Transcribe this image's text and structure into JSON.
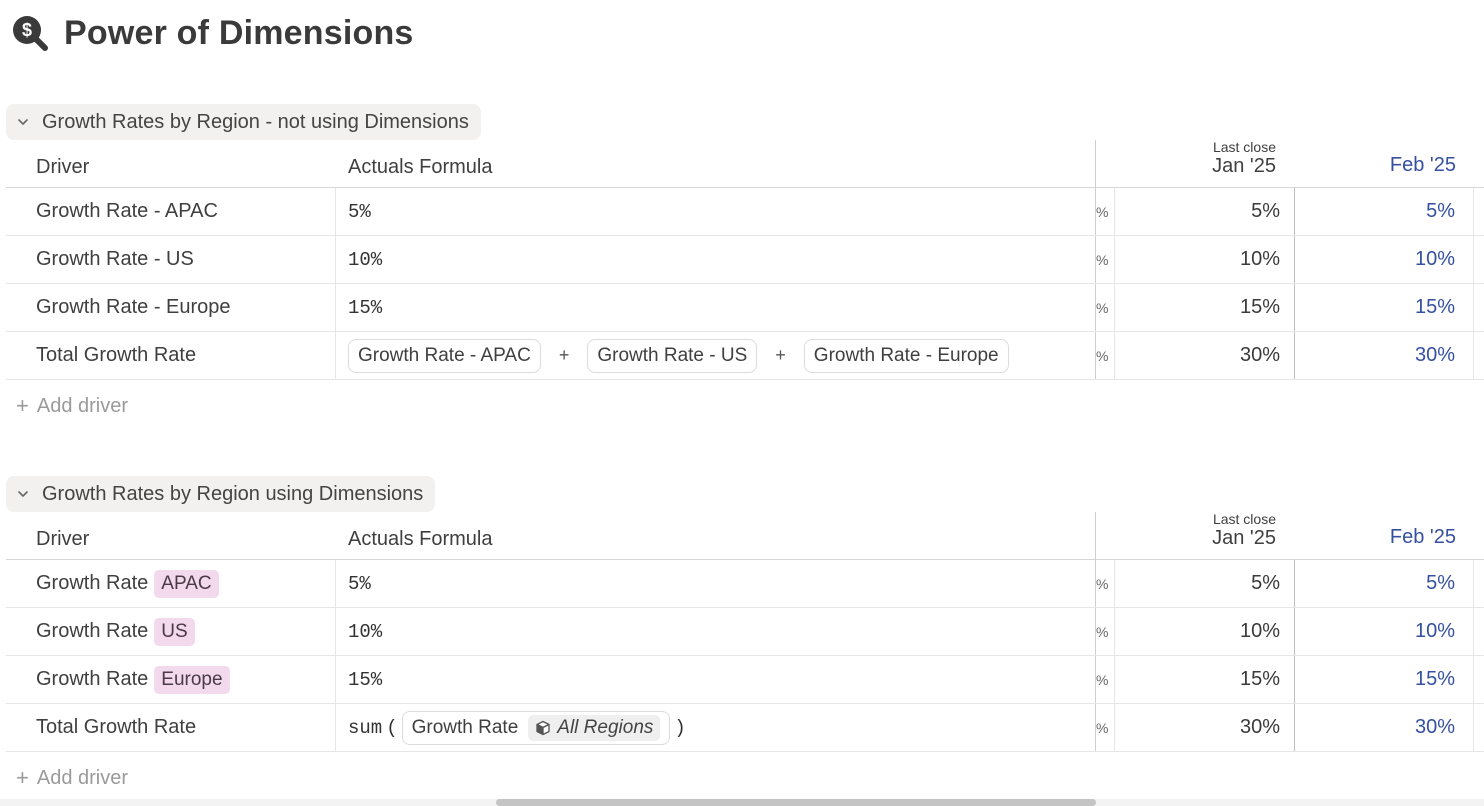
{
  "page": {
    "title": "Power of Dimensions",
    "icon": "search-dollar-icon"
  },
  "colors": {
    "accent_blue": "#3550a0",
    "dimension_tag": "#f3d9ec",
    "block_title_bg": "#f2f1ef"
  },
  "columns": {
    "driver": "Driver",
    "formula": "Actuals Formula",
    "jan_sub": "Last close",
    "jan": "Jan '25",
    "feb": "Feb '25"
  },
  "block1": {
    "title": "Growth Rates by Region - not using Dimensions",
    "rows": [
      {
        "driver": "Growth Rate - APAC",
        "formula": "5%",
        "stub": "%",
        "jan": "5%",
        "feb": "5%"
      },
      {
        "driver": "Growth Rate - US",
        "formula": "10%",
        "stub": "%",
        "jan": "10%",
        "feb": "10%"
      },
      {
        "driver": "Growth Rate - Europe",
        "formula": "15%",
        "stub": "%",
        "jan": "15%",
        "feb": "15%"
      },
      {
        "driver": "Total Growth Rate",
        "chips": [
          "Growth Rate - APAC",
          "Growth Rate - US",
          "Growth Rate - Europe"
        ],
        "op": "+",
        "stub": "%",
        "jan": "30%",
        "feb": "30%"
      }
    ],
    "add_driver": "Add driver"
  },
  "block2": {
    "title": "Growth Rates by Region using Dimensions",
    "rows": [
      {
        "driver": "Growth Rate",
        "tag": "APAC",
        "formula": "5%",
        "stub": "%",
        "jan": "5%",
        "feb": "5%"
      },
      {
        "driver": "Growth Rate",
        "tag": "US",
        "formula": "10%",
        "stub": "%",
        "jan": "10%",
        "feb": "10%"
      },
      {
        "driver": "Growth Rate",
        "tag": "Europe",
        "formula": "15%",
        "stub": "%",
        "jan": "15%",
        "feb": "15%"
      },
      {
        "driver": "Total Growth Rate",
        "fn": "sum",
        "open": "(",
        "close": ")",
        "chip": "Growth Rate",
        "all": "All Regions",
        "stub": "%",
        "jan": "30%",
        "feb": "30%"
      }
    ],
    "add_driver": "Add driver"
  }
}
